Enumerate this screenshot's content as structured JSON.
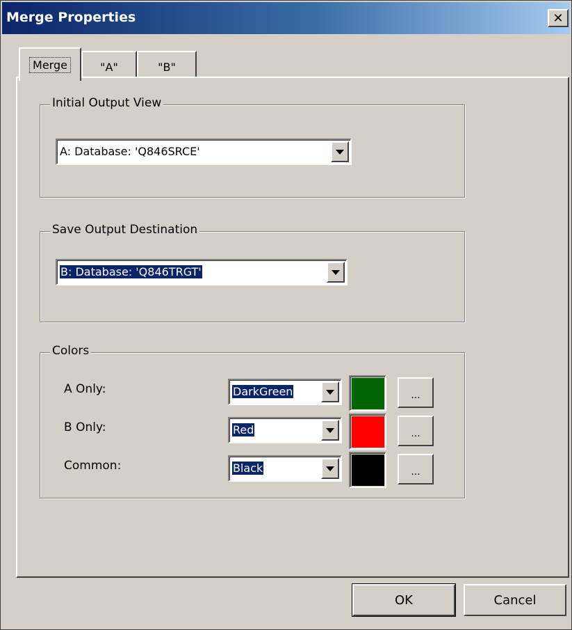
{
  "window": {
    "title": "Merge Properties",
    "close_glyph": "✕"
  },
  "tabs": [
    {
      "label": "Merge",
      "active": true
    },
    {
      "label": "\"A\"",
      "active": false
    },
    {
      "label": "\"B\"",
      "active": false
    }
  ],
  "initial_output_view": {
    "legend": "Initial Output View",
    "value": "A: Database: 'Q846SRCE'"
  },
  "save_output_destination": {
    "legend": "Save Output Destination",
    "value": "B: Database: 'Q846TRGT'",
    "selected": true
  },
  "colors": {
    "legend": "Colors",
    "rows": [
      {
        "label": "A Only:",
        "value": "DarkGreen",
        "swatch": "#006400",
        "button": "..."
      },
      {
        "label": "B Only:",
        "value": "Red",
        "swatch": "#ff0000",
        "button": "..."
      },
      {
        "label": "Common:",
        "value": "Black",
        "swatch": "#000000",
        "button": "..."
      }
    ]
  },
  "buttons": {
    "ok": "OK",
    "cancel": "Cancel"
  },
  "theme": {
    "face": "#d4d0c8",
    "title_start": "#0a246a",
    "title_end": "#a6caf0",
    "selection": "#0a246a"
  }
}
